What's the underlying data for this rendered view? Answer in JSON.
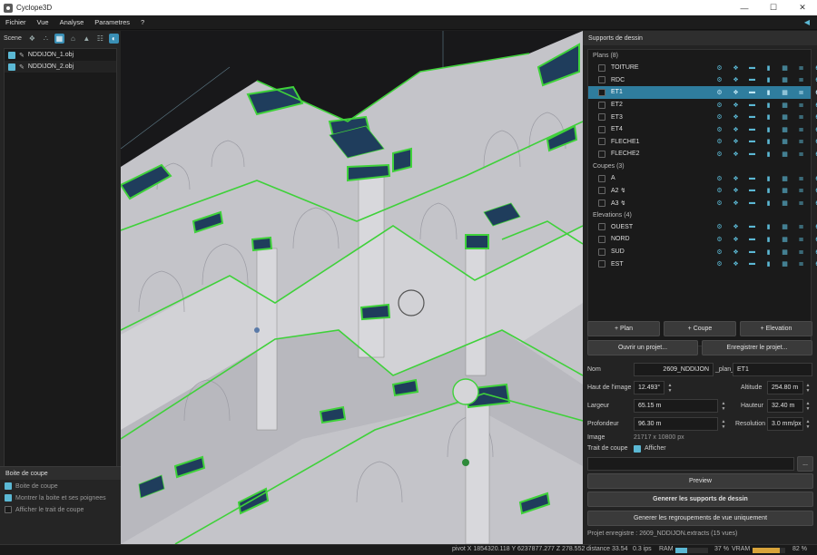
{
  "window": {
    "title": "Cyclope3D"
  },
  "menu": [
    "Fichier",
    "Vue",
    "Analyse",
    "Parametres",
    "?"
  ],
  "scene": {
    "label": "Scene",
    "files": [
      {
        "name": "NDDIJON_1.obj"
      },
      {
        "name": "NDDIJON_2.obj"
      }
    ]
  },
  "boite": {
    "title": "Boite de coupe",
    "options": [
      {
        "label": "Boite de coupe",
        "checked": true
      },
      {
        "label": "Montrer la boite et ses poignees",
        "checked": true
      },
      {
        "label": "Afficher le trait de coupe",
        "checked": false
      }
    ]
  },
  "supports": {
    "title": "Supports de dessin",
    "groups": [
      {
        "label": "Plans (8)",
        "items": [
          "TOITURE",
          "RDC",
          "ET1",
          "ET2",
          "ET3",
          "ET4",
          "FLECHE1",
          "FLECHE2"
        ]
      },
      {
        "label": "Coupes (3)",
        "items": [
          "A",
          "A2 ↯",
          "A3 ↯"
        ]
      },
      {
        "label": "Elevations (4)",
        "items": [
          "OUEST",
          "NORD",
          "SUD",
          "EST"
        ]
      }
    ],
    "selected": "ET1"
  },
  "buttons": {
    "add_plan": "+ Plan",
    "add_coupe": "+ Coupe",
    "add_elevation": "+ Elevation",
    "open_project": "Ouvrir un projet...",
    "save_project": "Enregistrer le projet...",
    "preview": "Preview",
    "generate": "Generer les supports de dessin",
    "generate_groups": "Generer les regroupements de vue uniquement",
    "browse": "..."
  },
  "form": {
    "nom_label": "Nom",
    "nom_value": "2609_NDDIJON",
    "plan_infix": "_plan_",
    "plan_value": "ET1",
    "haut_label": "Haut de l'image",
    "haut_value": "12.493°",
    "altitude_label": "Altitude",
    "altitude_value": "254.80 m",
    "largeur_label": "Largeur",
    "largeur_value": "65.15 m",
    "hauteur_label": "Hauteur",
    "hauteur_value": "32.40 m",
    "profondeur_label": "Profondeur",
    "profondeur_value": "96.30 m",
    "resolution_label": "Resolution",
    "resolution_value": "3.0 mm/px",
    "image_label": "Image",
    "image_value": "21717 x 10800 px",
    "trait_label": "Trait de coupe",
    "trait_value": "Afficher"
  },
  "project_status": "Projet enregistre : 2609_NDDIJON.extracts (15 vues)",
  "status": {
    "pivot": "pivot  X 1854320.118  Y 6237877.277  Z 278.552",
    "distance": "distance  33.54",
    "ips": "0.3 ips",
    "ram_label": "RAM",
    "ram_pct": "37 %",
    "ram_fill": 0.37,
    "vram_label": "VRAM",
    "vram_pct": "82 %",
    "vram_fill": 0.82
  },
  "colors": {
    "accent": "#5bb8d4",
    "selection": "#2f7d9e",
    "roof": "#1f3d5c",
    "edge": "#3fd13a",
    "model": "#c9c9cd"
  }
}
